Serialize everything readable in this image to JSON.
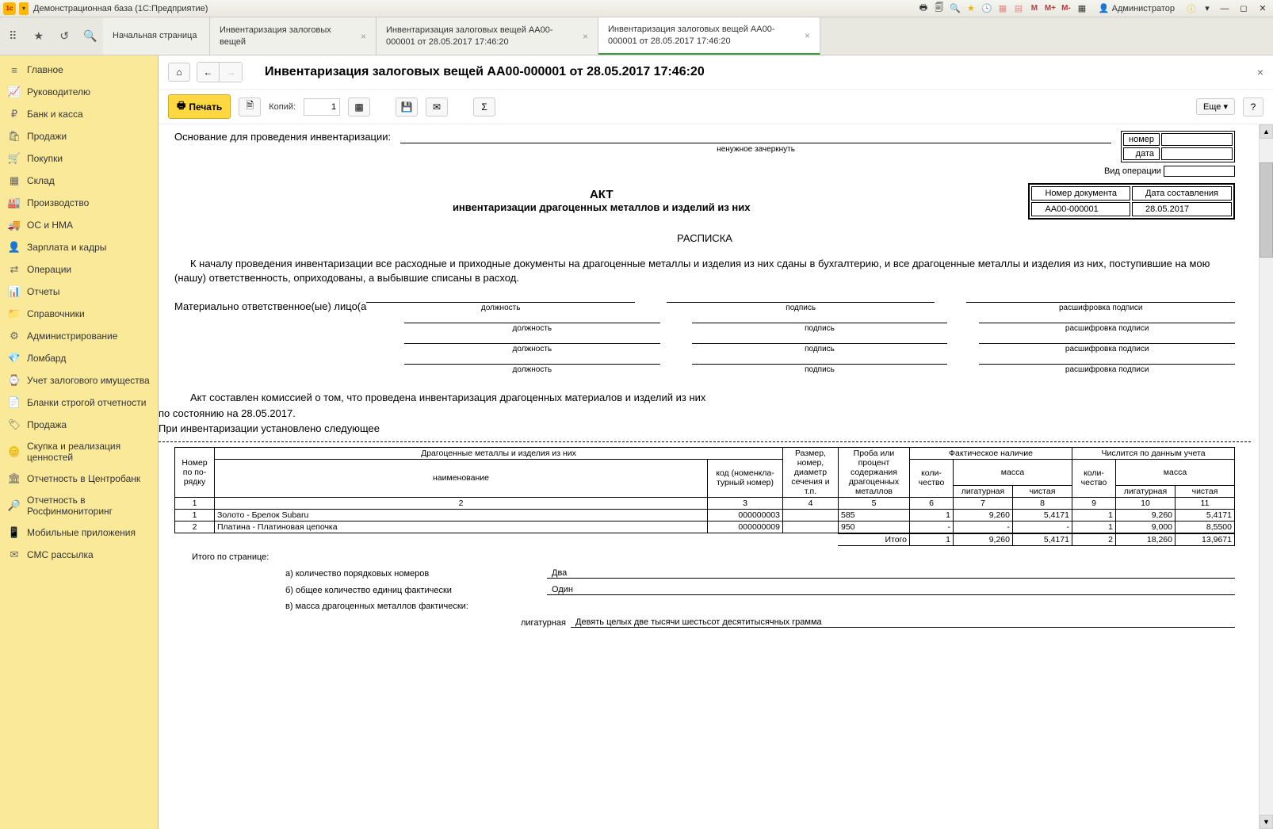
{
  "titlebar": {
    "app_name": "Демонстрационная база  (1С:Предприятие)",
    "user": "Администратор",
    "m": "M",
    "mplus": "M+",
    "mminus": "M-"
  },
  "tabs": {
    "t1": "Начальная страница",
    "t2": "Инвентаризация залоговых вещей",
    "t3": "Инвентаризация залоговых вещей АА00-000001 от 28.05.2017 17:46:20",
    "t4": "Инвентаризация залоговых вещей АА00-000001 от 28.05.2017 17:46:20"
  },
  "sidebar": {
    "items": [
      "Главное",
      "Руководителю",
      "Банк и касса",
      "Продажи",
      "Покупки",
      "Склад",
      "Производство",
      "ОС и НМА",
      "Зарплата и кадры",
      "Операции",
      "Отчеты",
      "Справочники",
      "Администрирование",
      "Ломбард",
      "Учет залогового имущества",
      "Бланки строгой отчетности",
      "Продажа",
      "Скупка и реализация ценностей",
      "Отчетность в Центробанк",
      "Отчетность в Росфинмониторинг",
      "Мобильные приложения",
      "СМС рассылка"
    ]
  },
  "page": {
    "title": "Инвентаризация залоговых вещей АА00-000001 от 28.05.2017 17:46:20"
  },
  "toolbar": {
    "print": "Печать",
    "copies_label": "Копий:",
    "copies_value": "1",
    "more": "Еще"
  },
  "doc": {
    "basis_label": "Основание для проведения инвентаризации:",
    "cross_out": "ненужное зачеркнуть",
    "side": {
      "number": "номер",
      "date": "дата",
      "op_type": "Вид операции"
    },
    "docnum": {
      "h1": "Номер документа",
      "h2": "Дата составления",
      "v1": "АА00-000001",
      "v2": "28.05.2017"
    },
    "title": "АКТ",
    "subtitle": "инвентаризации драгоценных металлов и изделий из них",
    "receipt": "РАСПИСКА",
    "para": "К началу проведения инвентаризации все расходные и приходные документы на драгоценные металлы и изделия из них сданы в бухгалтерию, и все драгоценные металлы и изделия из них, поступившие на мою (нашу) ответственность, оприходованы, а выбывшие списаны в расход.",
    "resp_label": "Материально ответственное(ые) лицо(а",
    "sig": {
      "pos": "должность",
      "sign": "подпись",
      "dec": "расшифровка подписи"
    },
    "act_made": "Акт составлен комиссией о том, что проведена инвентаризация драгоценных материалов и изделий из них",
    "as_of": "по состоянию на 28.05.2017.",
    "established": "При инвентаризации установлено следующее",
    "table": {
      "h": {
        "num": "Номер по по-рядку",
        "metals": "Драгоценные металлы и изделия из них",
        "name": "наименование",
        "code": "код (номенкла-турный номер)",
        "size": "Размер, номер, диаметр сечения и т.п.",
        "assay": "Проба или процент содержания драгоценных металлов",
        "actual": "Фактическое наличие",
        "book": "Числится по данным учета",
        "qty": "коли-чество",
        "mass": "масса",
        "lig": "лигатурная",
        "pure": "чистая"
      },
      "cols": [
        "1",
        "2",
        "3",
        "4",
        "5",
        "6",
        "7",
        "8",
        "9",
        "10",
        "11"
      ],
      "rows": [
        {
          "n": "1",
          "name": "Золото - Брелок Subaru",
          "code": "000000003",
          "size": "",
          "assay": "585",
          "q1": "1",
          "l1": "9,260",
          "p1": "5,4171",
          "q2": "1",
          "l2": "9,260",
          "p2": "5,4171"
        },
        {
          "n": "2",
          "name": "Платина - Платиновая цепочка",
          "code": "000000009",
          "size": "",
          "assay": "950",
          "q1": "-",
          "l1": "-",
          "p1": "-",
          "q2": "1",
          "l2": "9,000",
          "p2": "8,5500"
        }
      ],
      "total_label": "Итого",
      "totals": {
        "q1": "1",
        "l1": "9,260",
        "p1": "5,4171",
        "q2": "2",
        "l2": "18,260",
        "p2": "13,9671"
      }
    },
    "page_totals": {
      "label": "Итого по странице:",
      "a": "а) количество порядковых номеров",
      "a_val": "Два",
      "b": "б) общее количество единиц фактически",
      "b_val": "Один",
      "c": "в) масса драгоценных металлов фактически:",
      "c_lig_label": "лигатурная",
      "c_lig_val": "Девять целых две тысячи шестьсот десятитысячных грамма"
    }
  }
}
